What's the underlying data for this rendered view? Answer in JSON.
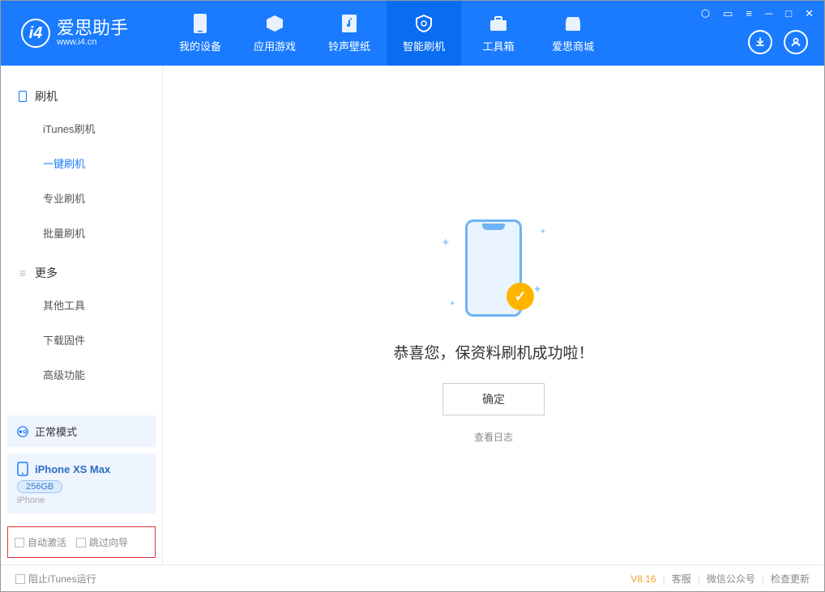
{
  "header": {
    "logo_title": "爱思助手",
    "logo_sub": "www.i4.cn",
    "tabs": [
      {
        "label": "我的设备"
      },
      {
        "label": "应用游戏"
      },
      {
        "label": "铃声壁纸"
      },
      {
        "label": "智能刷机"
      },
      {
        "label": "工具箱"
      },
      {
        "label": "爱思商城"
      }
    ]
  },
  "sidebar": {
    "section1_title": "刷机",
    "items1": [
      {
        "label": "iTunes刷机"
      },
      {
        "label": "一键刷机"
      },
      {
        "label": "专业刷机"
      },
      {
        "label": "批量刷机"
      }
    ],
    "section2_title": "更多",
    "items2": [
      {
        "label": "其他工具"
      },
      {
        "label": "下载固件"
      },
      {
        "label": "高级功能"
      }
    ],
    "mode_label": "正常模式",
    "device_name": "iPhone XS Max",
    "device_capacity": "256GB",
    "device_type": "iPhone",
    "check1": "自动激活",
    "check2": "跳过向导"
  },
  "main": {
    "success_msg": "恭喜您，保资料刷机成功啦！",
    "confirm_label": "确定",
    "log_link": "查看日志"
  },
  "footer": {
    "block_itunes": "阻止iTunes运行",
    "version": "V8.16",
    "link1": "客服",
    "link2": "微信公众号",
    "link3": "检查更新"
  }
}
